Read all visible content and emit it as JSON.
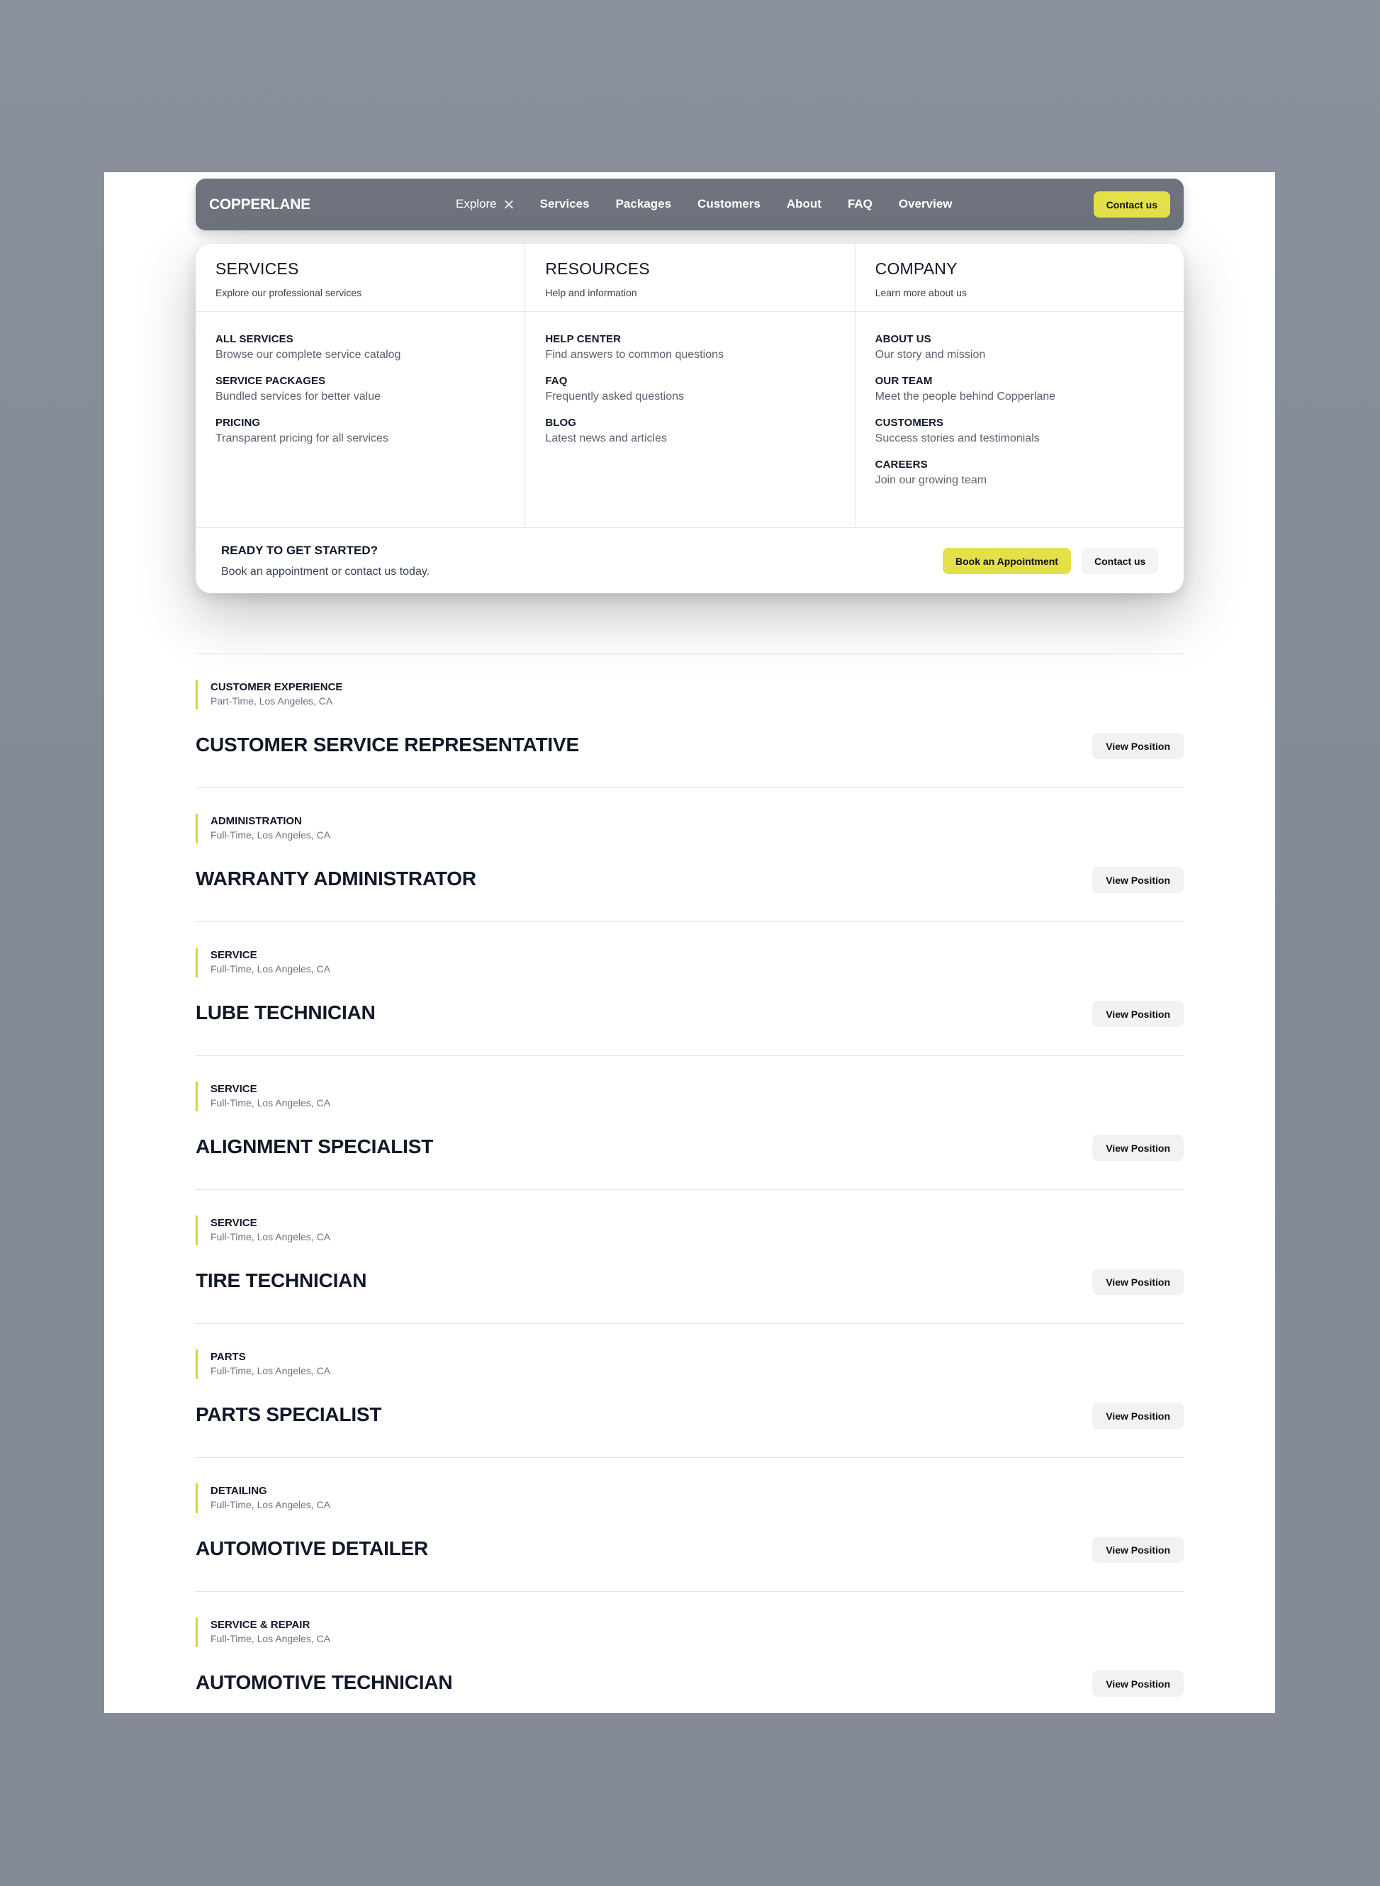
{
  "navbar": {
    "logo": "COPPERLANE",
    "links": [
      "Explore",
      "Services",
      "Packages",
      "Customers",
      "About",
      "FAQ",
      "Overview"
    ],
    "contact_label": "Contact us"
  },
  "dropdown": {
    "columns": [
      {
        "title": "SERVICES",
        "subtitle": "Explore our professional services",
        "items": [
          {
            "title": "ALL SERVICES",
            "desc": "Browse our complete service catalog"
          },
          {
            "title": "SERVICE PACKAGES",
            "desc": "Bundled services for better value"
          },
          {
            "title": "PRICING",
            "desc": "Transparent pricing for all services"
          }
        ]
      },
      {
        "title": "RESOURCES",
        "subtitle": "Help and information",
        "items": [
          {
            "title": "HELP CENTER",
            "desc": "Find answers to common questions"
          },
          {
            "title": "FAQ",
            "desc": "Frequently asked questions"
          },
          {
            "title": "BLOG",
            "desc": "Latest news and articles"
          }
        ]
      },
      {
        "title": "COMPANY",
        "subtitle": "Learn more about us",
        "items": [
          {
            "title": "ABOUT US",
            "desc": "Our story and mission"
          },
          {
            "title": "OUR TEAM",
            "desc": "Meet the people behind Copperlane"
          },
          {
            "title": "CUSTOMERS",
            "desc": "Success stories and testimonials"
          },
          {
            "title": "CAREERS",
            "desc": "Join our growing team"
          }
        ]
      }
    ],
    "footer": {
      "title": "READY TO GET STARTED?",
      "subtitle": "Book an appointment or contact us today.",
      "book_label": "Book an Appointment",
      "contact_label": "Contact us"
    }
  },
  "positions": [
    {
      "dept": "CUSTOMER EXPERIENCE",
      "loc": "Part-Time, Los Angeles, CA",
      "title": "CUSTOMER SERVICE REPRESENTATIVE",
      "button": "View Position"
    },
    {
      "dept": "ADMINISTRATION",
      "loc": "Full-Time, Los Angeles, CA",
      "title": "WARRANTY ADMINISTRATOR",
      "button": "View Position"
    },
    {
      "dept": "SERVICE",
      "loc": "Full-Time, Los Angeles, CA",
      "title": "LUBE TECHNICIAN",
      "button": "View Position"
    },
    {
      "dept": "SERVICE",
      "loc": "Full-Time, Los Angeles, CA",
      "title": "ALIGNMENT SPECIALIST",
      "button": "View Position"
    },
    {
      "dept": "SERVICE",
      "loc": "Full-Time, Los Angeles, CA",
      "title": "TIRE TECHNICIAN",
      "button": "View Position"
    },
    {
      "dept": "PARTS",
      "loc": "Full-Time, Los Angeles, CA",
      "title": "PARTS SPECIALIST",
      "button": "View Position"
    },
    {
      "dept": "DETAILING",
      "loc": "Full-Time, Los Angeles, CA",
      "title": "AUTOMOTIVE DETAILER",
      "button": "View Position"
    },
    {
      "dept": "SERVICE & REPAIR",
      "loc": "Full-Time, Los Angeles, CA",
      "title": "AUTOMOTIVE TECHNICIAN",
      "button": "View Position"
    }
  ],
  "colors": {
    "accent": "#e3e04a",
    "navbar": "#6e737d",
    "backdrop": "#868c97"
  }
}
